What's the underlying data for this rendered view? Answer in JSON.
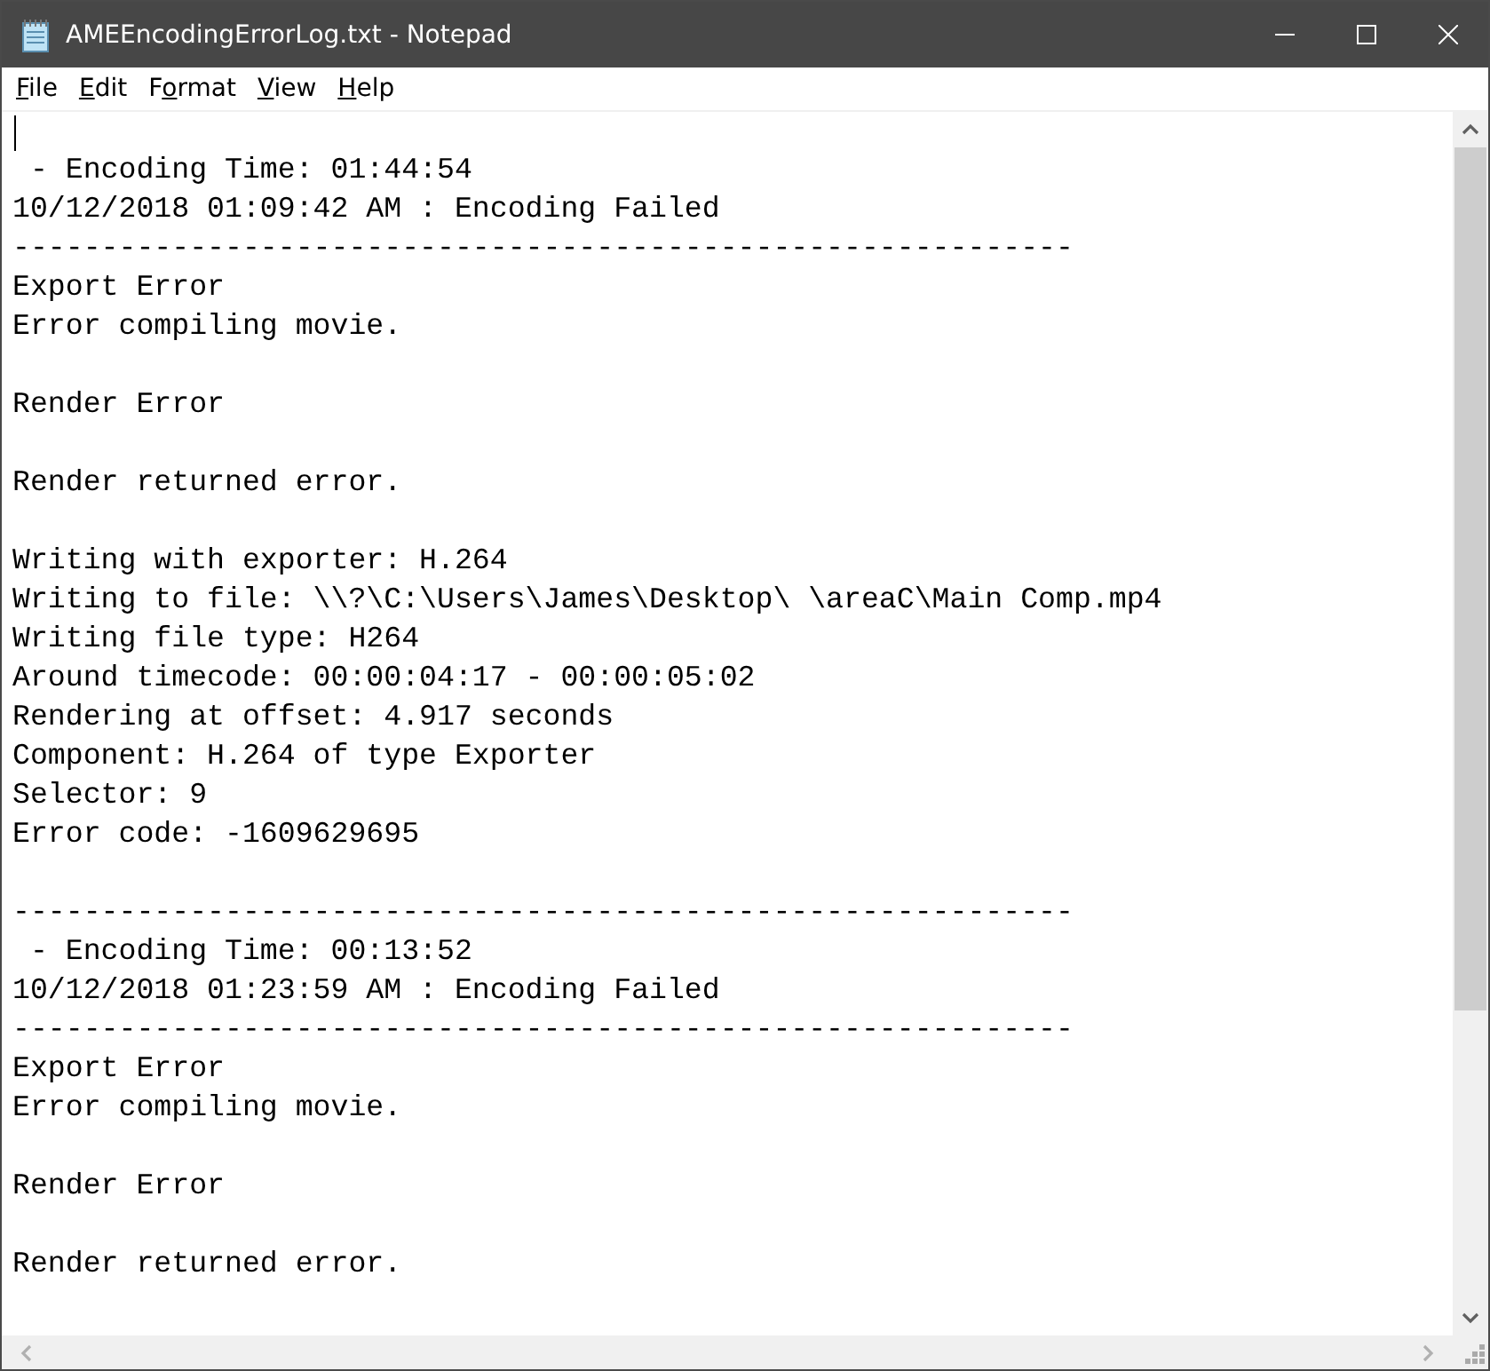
{
  "window": {
    "title": "AMEEncodingErrorLog.txt - Notepad"
  },
  "menu": [
    {
      "parts": [
        {
          "text": "F",
          "underlined": true
        },
        {
          "text": "ile",
          "underlined": false
        }
      ]
    },
    {
      "parts": [
        {
          "text": "E",
          "underlined": true
        },
        {
          "text": "dit",
          "underlined": false
        }
      ]
    },
    {
      "parts": [
        {
          "text": "F",
          "underlined": false
        },
        {
          "text": "o",
          "underlined": true
        },
        {
          "text": "rmat",
          "underlined": false
        }
      ]
    },
    {
      "parts": [
        {
          "text": "V",
          "underlined": true
        },
        {
          "text": "iew",
          "underlined": false
        }
      ]
    },
    {
      "parts": [
        {
          "text": "H",
          "underlined": true
        },
        {
          "text": "elp",
          "underlined": false
        }
      ]
    }
  ],
  "editor": {
    "lines": [
      {
        "kind": "blank"
      },
      {
        "kind": "text",
        "text": " - Encoding Time: 01:44:54"
      },
      {
        "kind": "text",
        "text": "10/12/2018 01:09:42 AM : Encoding Failed"
      },
      {
        "kind": "text",
        "text": "------------------------------------------------------------"
      },
      {
        "kind": "text",
        "text": "Export Error"
      },
      {
        "kind": "text",
        "text": "Error compiling movie."
      },
      {
        "kind": "blank"
      },
      {
        "kind": "text",
        "text": "Render Error"
      },
      {
        "kind": "blank"
      },
      {
        "kind": "text",
        "text": "Render returned error."
      },
      {
        "kind": "blank"
      },
      {
        "kind": "text",
        "text": "Writing with exporter: H.264"
      },
      {
        "kind": "text",
        "text": "Writing to file: \\\\?\\C:\\Users\\James\\Desktop\\ \\areaC\\Main Comp.mp4"
      },
      {
        "kind": "text",
        "text": "Writing file type: H264"
      },
      {
        "kind": "text",
        "text": "Around timecode: 00:00:04:17 - 00:00:05:02"
      },
      {
        "kind": "text",
        "text": "Rendering at offset: 4.917 seconds"
      },
      {
        "kind": "text",
        "text": "Component: H.264 of type Exporter"
      },
      {
        "kind": "text",
        "text": "Selector: 9"
      },
      {
        "kind": "text",
        "text": "Error code: -1609629695"
      },
      {
        "kind": "blank"
      },
      {
        "kind": "text",
        "text": "------------------------------------------------------------"
      },
      {
        "kind": "text",
        "text": " - Encoding Time: 00:13:52"
      },
      {
        "kind": "text",
        "text": "10/12/2018 01:23:59 AM : Encoding Failed"
      },
      {
        "kind": "text",
        "text": "------------------------------------------------------------"
      },
      {
        "kind": "text",
        "text": "Export Error"
      },
      {
        "kind": "text",
        "text": "Error compiling movie."
      },
      {
        "kind": "blank"
      },
      {
        "kind": "text",
        "text": "Render Error"
      },
      {
        "kind": "blank"
      },
      {
        "kind": "text",
        "text": "Render returned error."
      },
      {
        "kind": "blank"
      }
    ]
  }
}
